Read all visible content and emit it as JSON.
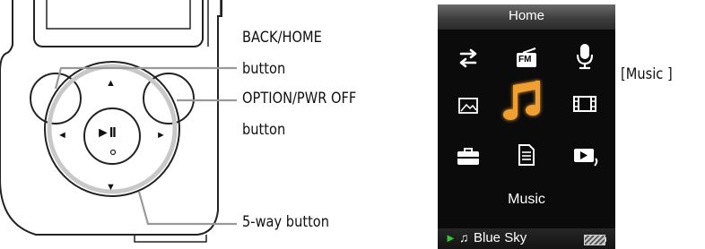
{
  "callouts": {
    "back_home": [
      "BACK/HOME",
      "button"
    ],
    "option_pwr": [
      "OPTION/PWR OFF",
      "button"
    ],
    "five_way": "5-way button",
    "music": "[Music ]"
  },
  "device": {
    "play_pause_glyph": "►II",
    "arrow_up": "▲",
    "arrow_down": "▼",
    "arrow_left": "◄",
    "arrow_right": "►"
  },
  "screen": {
    "header_title": "Home",
    "icons": [
      {
        "name": "repeat-icon"
      },
      {
        "name": "fm-radio-icon",
        "text": "FM"
      },
      {
        "name": "microphone-icon"
      },
      {
        "name": "photo-icon"
      },
      {
        "name": "music-note-icon",
        "selected": true
      },
      {
        "name": "video-film-icon"
      },
      {
        "name": "settings-toolbox-icon"
      },
      {
        "name": "podcast-document-icon"
      },
      {
        "name": "now-playing-icon"
      }
    ],
    "selected_label": "Music",
    "status": {
      "play_glyph": "►",
      "note_glyph": "♫",
      "track": "Blue Sky"
    }
  },
  "colors": {
    "selected_icon": "#f0a030",
    "icon_white": "#ffffff",
    "play_green": "#34c834"
  }
}
